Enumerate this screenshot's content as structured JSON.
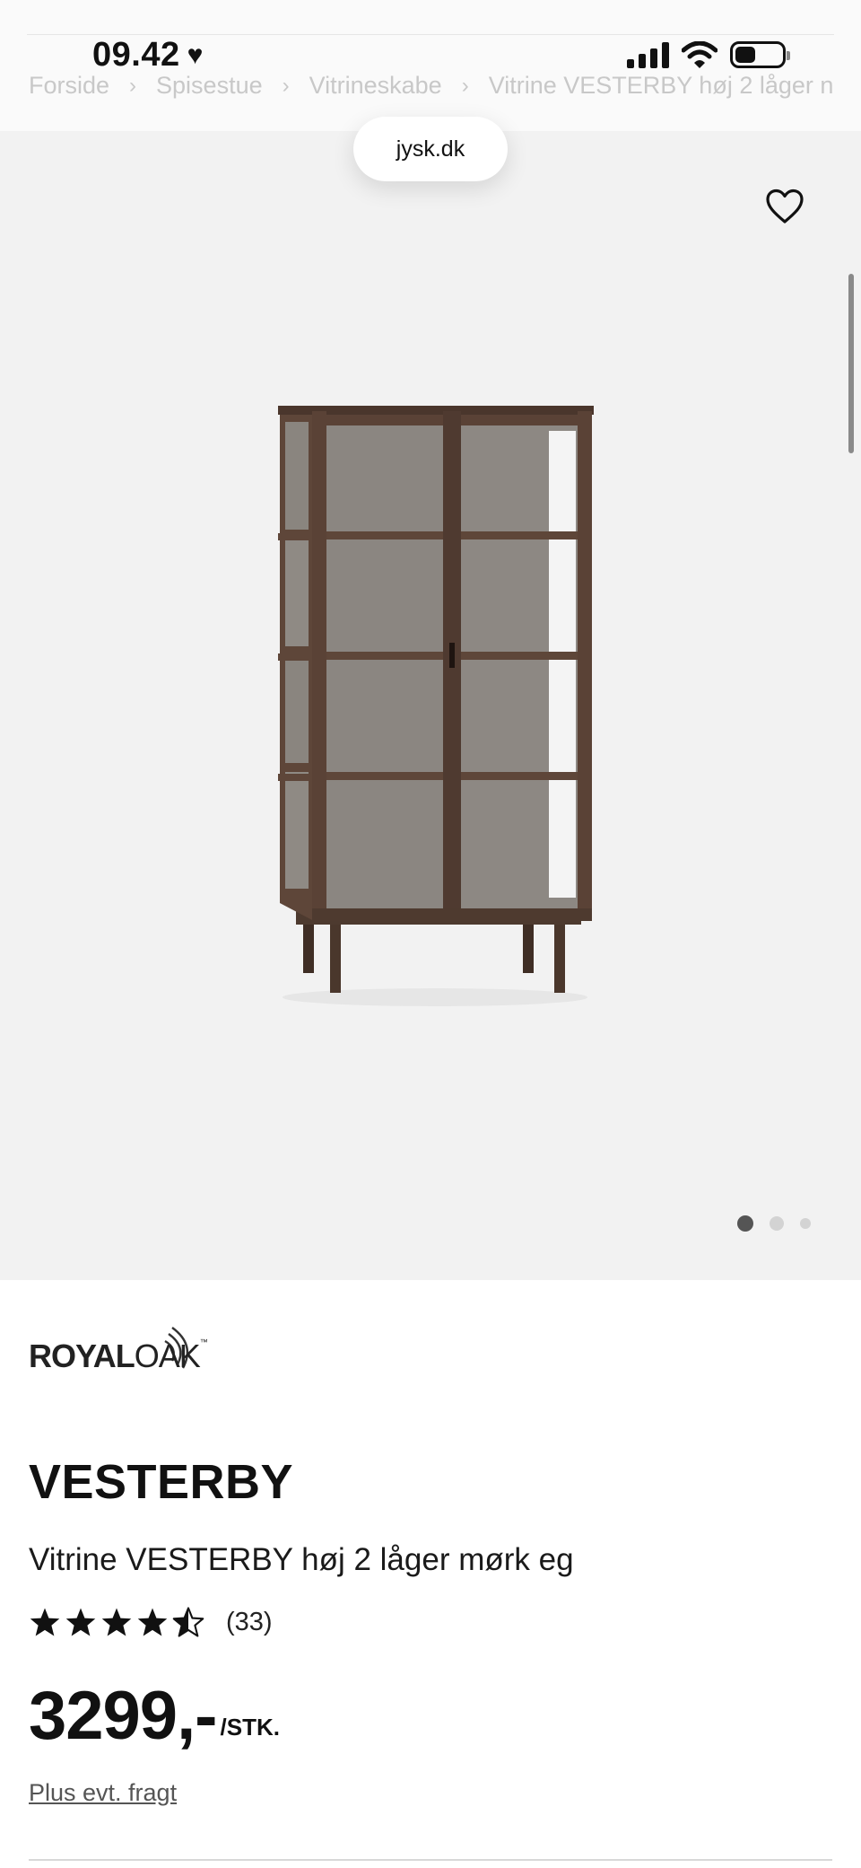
{
  "status_bar": {
    "time": "09.42",
    "heart_icon": "heart-filled-icon",
    "icons": [
      "signal-icon",
      "wifi-icon",
      "battery-icon"
    ]
  },
  "breadcrumb": {
    "items": [
      "Forside",
      "Spisestue",
      "Vitrineskabe",
      "Vitrine VESTERBY høj 2 låger n"
    ],
    "separator": "›"
  },
  "browser": {
    "url": "jysk.dk"
  },
  "gallery": {
    "wishlist_icon": "heart-outline-icon",
    "image_alt": "product-image-cabinet",
    "dots": {
      "count": 3,
      "active": 0
    }
  },
  "product": {
    "brand": {
      "part1": "ROYAL",
      "part2": "OAK",
      "mark": "™"
    },
    "title": "VESTERBY",
    "subtitle": "Vitrine VESTERBY høj 2 låger mørk eg",
    "rating": {
      "value": 4.5,
      "max": 5,
      "count": "(33)"
    },
    "price": "3299,-",
    "unit": "/STK.",
    "shipping": "Plus evt. fragt"
  },
  "colors": {
    "gallery_bg": "#f2f2f2",
    "wood": "#5a4236",
    "text": "#111111"
  }
}
